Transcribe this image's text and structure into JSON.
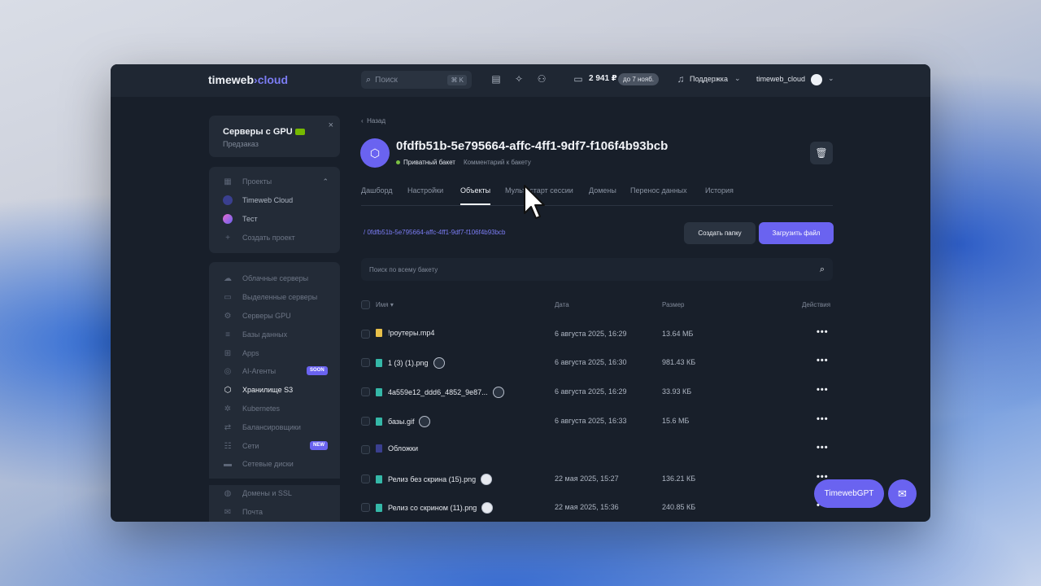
{
  "topbar": {
    "logo_main": "timeweb",
    "logo_accent": "cloud",
    "search_placeholder": "Поиск",
    "search_shortcut": "⌘ K",
    "balance": "2 941 ₽",
    "balance_badge": "до 7 нояб.",
    "support": "Поддержка",
    "user": "timeweb_cloud",
    "icons": [
      "docs-icon",
      "bulb-icon",
      "add-user-icon",
      "wallet-icon",
      "headset-icon",
      "user-avatar-icon"
    ]
  },
  "gpu_promo": {
    "title": "Серверы с GPU",
    "subtitle": "Предзаказ"
  },
  "projects": {
    "header": "Проекты",
    "items": [
      "Timeweb Cloud",
      "Тест"
    ],
    "create": "Создать проект"
  },
  "sidebar": {
    "items": [
      {
        "label": "Облачные серверы",
        "icon": "cloud-icon"
      },
      {
        "label": "Выделенные серверы",
        "icon": "server-icon"
      },
      {
        "label": "Серверы GPU",
        "icon": "gpu-icon"
      },
      {
        "label": "Базы данных",
        "icon": "database-icon"
      },
      {
        "label": "Apps",
        "icon": "apps-icon"
      },
      {
        "label": "AI-Агенты",
        "icon": "ai-icon",
        "badge": "SOON"
      },
      {
        "label": "Хранилище S3",
        "icon": "storage-icon",
        "active": true
      },
      {
        "label": "Kubernetes",
        "icon": "kubernetes-icon"
      },
      {
        "label": "Балансировщики",
        "icon": "balancer-icon"
      },
      {
        "label": "Сети",
        "icon": "network-icon",
        "badge": "NEW"
      },
      {
        "label": "Сетевые диски",
        "icon": "disk-icon"
      }
    ],
    "items2": [
      {
        "label": "Домены и SSL",
        "icon": "globe-icon"
      },
      {
        "label": "Почта",
        "icon": "mail-icon"
      }
    ]
  },
  "bucket": {
    "back": "Назад",
    "name": "0fdfb51b-5e795664-affc-4ff1-9df7-f106f4b93bcb",
    "privacy": "Приватный бакет",
    "comment": "Комментарий к бакету"
  },
  "tabs": [
    "Дашборд",
    "Настройки",
    "Объекты",
    "Мультистарт сессии",
    "Домены",
    "Перенос данных",
    "История"
  ],
  "objects": {
    "breadcrumb": "/ 0fdfb51b-5e795664-affc-4ff1-9df7-f106f4b93bcb",
    "create_folder": "Создать папку",
    "upload": "Загрузить файл",
    "search_placeholder": "Поиск по всему бакету",
    "columns": {
      "name": "Имя",
      "date": "Дата",
      "size": "Размер",
      "action": "Действия"
    },
    "rows": [
      {
        "name": "!роутеры.mp4",
        "date": "6 августа 2025, 16:29",
        "size": "13.64 МБ",
        "type": "video"
      },
      {
        "name": "1 (3) (1).png",
        "date": "6 августа 2025, 16:30",
        "size": "981.43 КБ",
        "type": "image"
      },
      {
        "name": "4a559e12_ddd6_4852_9e87...",
        "date": "6 августа 2025, 16:29",
        "size": "33.93 КБ",
        "type": "image"
      },
      {
        "name": "базы.gif",
        "date": "6 августа 2025, 16:33",
        "size": "15.6 МБ",
        "type": "image"
      },
      {
        "name": "Обложки",
        "date": "",
        "size": "",
        "type": "folder"
      },
      {
        "name": "Релиз без скрина (15).png",
        "date": "22 мая 2025, 15:27",
        "size": "136.21 КБ",
        "type": "image"
      },
      {
        "name": "Релиз со скрином (11).png",
        "date": "22 мая 2025, 15:36",
        "size": "240.85 КБ",
        "type": "image"
      }
    ],
    "more": "•••"
  },
  "assistant": {
    "gpt_label": "TimewebGPT"
  }
}
